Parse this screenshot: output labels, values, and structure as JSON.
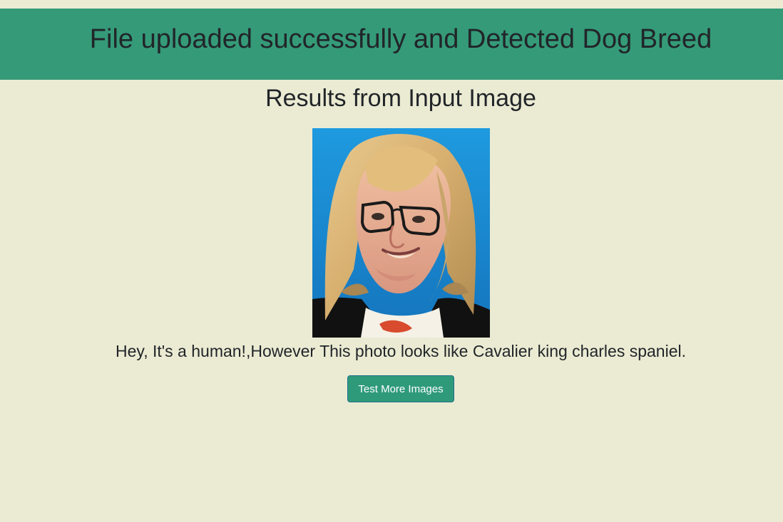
{
  "header": {
    "title": "File uploaded successfully and Detected Dog Breed"
  },
  "main": {
    "section_title": "Results from Input Image",
    "result_text": "Hey, It's a human!,However This photo looks like Cavalier king charles spaniel.",
    "test_more_label": "Test More Images",
    "input_image_alt": "Uploaded input image"
  },
  "colors": {
    "page_background": "#ebebd3",
    "banner_background": "#359a78",
    "button_background": "#2f9a7a",
    "button_border": "#1f6f8b",
    "text": "#212529"
  }
}
